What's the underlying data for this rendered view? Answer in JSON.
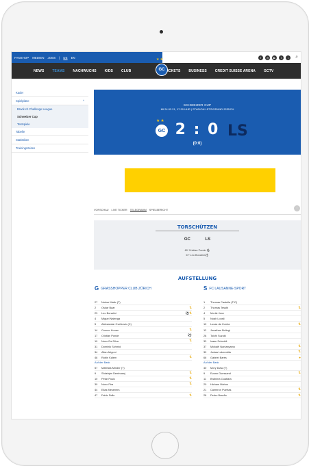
{
  "topbar": {
    "links": [
      "FANSHOP",
      "MEDIEN",
      "JOBS",
      "|",
      "DE",
      "EN"
    ],
    "social_icons": [
      "facebook-icon",
      "instagram-icon",
      "youtube-icon",
      "twitter-icon",
      "tiktok-icon"
    ],
    "search_icon": "search-icon"
  },
  "mainnav": {
    "left": [
      "NEWS",
      "TEAMS",
      "NACHWUCHS",
      "KIDS",
      "CLUB"
    ],
    "right": [
      "TICKETS",
      "BUSINESS",
      "CREDIT SUISSE ARENA",
      "GCTV"
    ],
    "logo_text": "GC"
  },
  "sidebar": {
    "kader": "Kader",
    "spielplaene": "Spielpläne",
    "chevron": "^",
    "sub": [
      "Brack.ch Challenge League",
      "Schweizer Cup",
      "Testspiele"
    ],
    "tabelle": "Tabelle",
    "statistiken": "Statistiken",
    "trainingszeiten": "Trainingszeiten"
  },
  "match": {
    "competition": "SCHWEIZER CUP",
    "info": "MI 24.02.21, 17:30 UHR | STADION LETZIGRUND ZÜRICH",
    "score": "2 : 0",
    "halftime": "(0:0)",
    "home_logo": "GC",
    "away_logo": "LS"
  },
  "tabs": [
    "VORSCHAU",
    "LIVE TICKER",
    "TELEGRAMM",
    "SPIELBERICHT"
  ],
  "scorers": {
    "title": "TORSCHÜTZEN",
    "teams": "GC LS",
    "events": [
      "80' Cristian Ponde ⚽",
      "67' Leo Bonatini ⚽"
    ]
  },
  "lineup": {
    "title": "AUFSTELLUNG",
    "home_team": "GRASSHOPPER CLUB ZÜRICH",
    "away_team": "FC LAUSANNE-SPORT",
    "home_players": [
      {
        "num": "27",
        "name": "Nurise Matic (T)",
        "ev": ""
      },
      {
        "num": "2",
        "name": "Oskar Baar",
        "ev": "⇅"
      },
      {
        "num": "23",
        "name": "Leo Bonatini",
        "ev": "⚽⇅"
      },
      {
        "num": "4",
        "name": "Miguel Nalenga",
        "ev": ""
      },
      {
        "num": "5",
        "name": "Aleksandar Cvetkovic (C)",
        "ev": ""
      },
      {
        "num": "14",
        "name": "Connor Konan",
        "ev": "⇅"
      },
      {
        "num": "17",
        "name": "Cristian Ponde",
        "ev": "⚽"
      },
      {
        "num": "19",
        "name": "Nuno Da Silva",
        "ev": "⇅"
      },
      {
        "num": "31",
        "name": "Dominik Schmid",
        "ev": ""
      },
      {
        "num": "34",
        "name": "Allan Arigoni",
        "ev": ""
      },
      {
        "num": "48",
        "name": "Robin Kalem",
        "ev": "⇅"
      }
    ],
    "away_players": [
      {
        "num": "1",
        "name": "Thomas Castella (T/C)",
        "ev": ""
      },
      {
        "num": "2",
        "name": "Thomas Tessbi",
        "ev": "⇅"
      },
      {
        "num": "4",
        "name": "Moritz Jenz",
        "ev": ""
      },
      {
        "num": "5",
        "name": "Noah Loosli",
        "ev": ""
      },
      {
        "num": "10",
        "name": "Lucas da Cunha",
        "ev": "⇅"
      },
      {
        "num": "12",
        "name": "Jonathan Bolingi",
        "ev": ""
      },
      {
        "num": "28",
        "name": "Toichi Suzuki",
        "ev": ""
      },
      {
        "num": "33",
        "name": "Isaac Schmidt",
        "ev": ""
      },
      {
        "num": "37",
        "name": "Mickaël Nanizayamo",
        "ev": "⇅"
      },
      {
        "num": "39",
        "name": "Josias Lukembila",
        "ev": "⇅"
      },
      {
        "num": "66",
        "name": "Gabriel Barés",
        "ev": "●"
      }
    ],
    "bench_label": "Auf der Bank",
    "home_bench": [
      {
        "num": "57",
        "name": "Matthias Minder (T)",
        "ev": ""
      },
      {
        "num": "9",
        "name": "Shkelqim Demhasaj",
        "ev": "⇅"
      },
      {
        "num": "10",
        "name": "Petar Pusic",
        "ev": "⇅"
      },
      {
        "num": "30",
        "name": "Nuno Fira",
        "ev": "⇅"
      },
      {
        "num": "44",
        "name": "Elias Meseners",
        "ev": ""
      },
      {
        "num": "47",
        "name": "Fabio Pelle",
        "ev": "⇅"
      }
    ],
    "away_bench": [
      {
        "num": "40",
        "name": "Mory Diaw (T)",
        "ev": ""
      },
      {
        "num": "9",
        "name": "Evann Guessand",
        "ev": "⇅"
      },
      {
        "num": "11",
        "name": "Brahima Ouattara",
        "ev": ""
      },
      {
        "num": "20",
        "name": "Hicham Mahou",
        "ev": ""
      },
      {
        "num": "21",
        "name": "Cameron Puertas",
        "ev": "⇅"
      },
      {
        "num": "28",
        "name": "Pedro Brazão",
        "ev": "⇅"
      }
    ]
  }
}
